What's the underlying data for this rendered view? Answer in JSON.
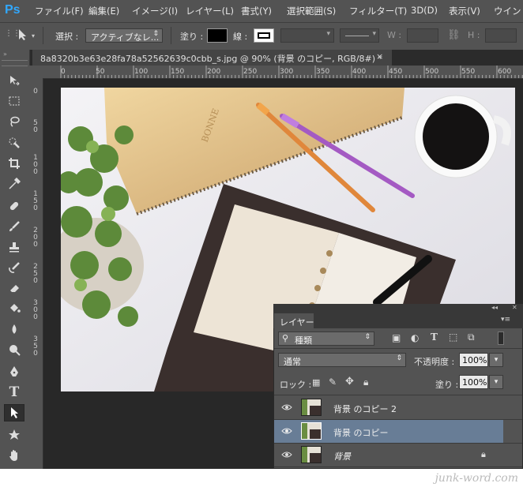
{
  "app": {
    "logo": "Ps"
  },
  "menu": [
    "ファイル(F)",
    "編集(E)",
    "イメージ(I)",
    "レイヤー(L)",
    "書式(Y)",
    "選択範囲(S)",
    "フィルター(T)",
    "3D(D)",
    "表示(V)",
    "ウインド"
  ],
  "options": {
    "select_label": "選択 :",
    "select_value": "アクティブなレ...",
    "fill_label": "塗り :",
    "stroke_label": "線 :",
    "w_label": "W :",
    "h_label": "H :"
  },
  "document": {
    "tab_title": "8a8320b3e63e28fa78a52562639c0cbb_s.jpg @ 90% (背景 のコピー, RGB/8#) *",
    "close": "×"
  },
  "ruler_h": [
    "0",
    "50",
    "100",
    "150",
    "200",
    "250",
    "300",
    "350",
    "400",
    "450",
    "500",
    "550",
    "600"
  ],
  "ruler_v": [
    "0",
    "5",
    "0",
    "1",
    "0",
    "0",
    "1",
    "5",
    "0",
    "2",
    "0",
    "0",
    "2",
    "5",
    "0",
    "3",
    "0",
    "0",
    "3",
    "5",
    "0"
  ],
  "layers_panel": {
    "tab": "レイヤー",
    "filter_kind": "種類",
    "blend_mode": "通常",
    "opacity_label": "不透明度 :",
    "opacity_value": "100%",
    "lock_label": "ロック :",
    "fill_label": "塗り :",
    "fill_value": "100%",
    "layers": [
      {
        "name": "背景 のコピー 2",
        "selected": false,
        "locked": false
      },
      {
        "name": "背景 のコピー",
        "selected": true,
        "locked": false
      },
      {
        "name": "背景",
        "selected": false,
        "locked": true
      }
    ]
  },
  "watermark": "junk-word.com",
  "colors": {
    "selected_row": "#687d96",
    "panel": "#535353",
    "workspace": "#282828"
  }
}
